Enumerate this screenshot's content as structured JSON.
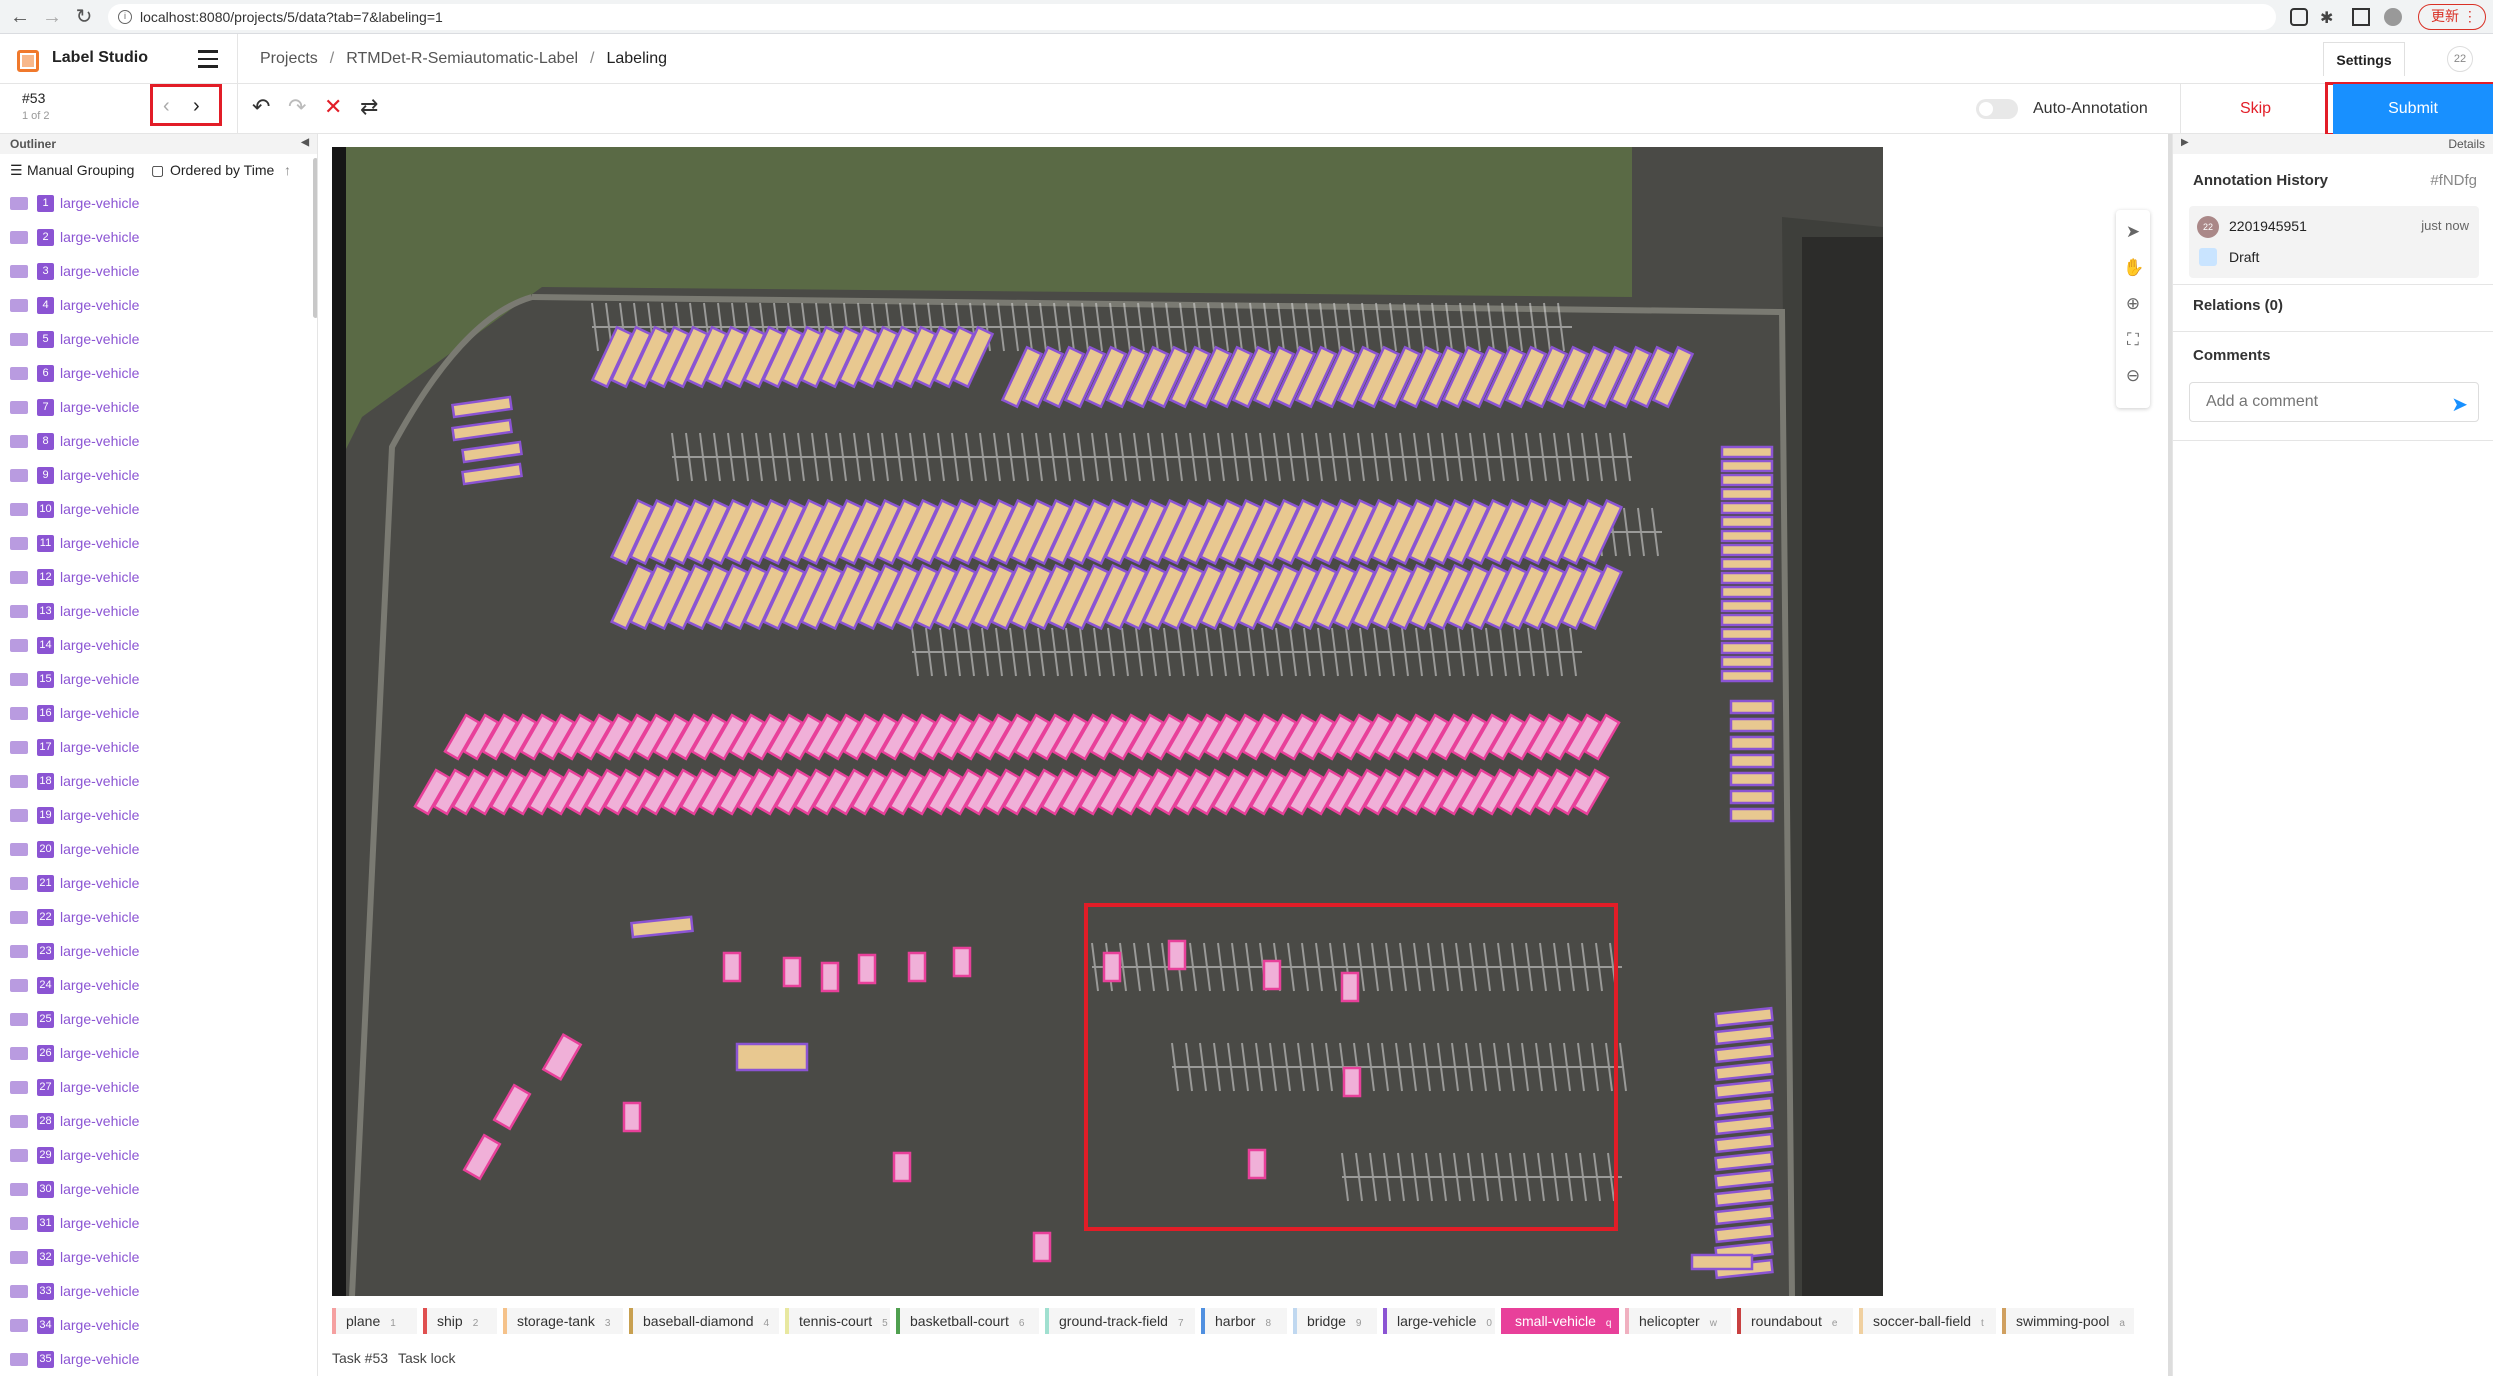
{
  "browser": {
    "url": "localhost:8080/projects/5/data?tab=7&labeling=1",
    "update_label": "更新"
  },
  "header": {
    "app_name": "Label Studio",
    "breadcrumb": [
      "Projects",
      "RTMDet-R-Semiautomatic-Label",
      "Labeling"
    ],
    "settings_label": "Settings",
    "user_count": "22"
  },
  "toolbar": {
    "task_id": "#53",
    "task_position": "1 of 2",
    "auto_annotation_label": "Auto-Annotation",
    "skip_label": "Skip",
    "submit_label": "Submit"
  },
  "outliner": {
    "title": "Outliner",
    "grouping_label": "Manual Grouping",
    "ordering_label": "Ordered by Time",
    "region_color": "#8b54d3",
    "regions": [
      {
        "n": "1",
        "label": "large-vehicle"
      },
      {
        "n": "2",
        "label": "large-vehicle"
      },
      {
        "n": "3",
        "label": "large-vehicle"
      },
      {
        "n": "4",
        "label": "large-vehicle"
      },
      {
        "n": "5",
        "label": "large-vehicle"
      },
      {
        "n": "6",
        "label": "large-vehicle"
      },
      {
        "n": "7",
        "label": "large-vehicle"
      },
      {
        "n": "8",
        "label": "large-vehicle"
      },
      {
        "n": "9",
        "label": "large-vehicle"
      },
      {
        "n": "10",
        "label": "large-vehicle"
      },
      {
        "n": "11",
        "label": "large-vehicle"
      },
      {
        "n": "12",
        "label": "large-vehicle"
      },
      {
        "n": "13",
        "label": "large-vehicle"
      },
      {
        "n": "14",
        "label": "large-vehicle"
      },
      {
        "n": "15",
        "label": "large-vehicle"
      },
      {
        "n": "16",
        "label": "large-vehicle"
      },
      {
        "n": "17",
        "label": "large-vehicle"
      },
      {
        "n": "18",
        "label": "large-vehicle"
      },
      {
        "n": "19",
        "label": "large-vehicle"
      },
      {
        "n": "20",
        "label": "large-vehicle"
      },
      {
        "n": "21",
        "label": "large-vehicle"
      },
      {
        "n": "22",
        "label": "large-vehicle"
      },
      {
        "n": "23",
        "label": "large-vehicle"
      },
      {
        "n": "24",
        "label": "large-vehicle"
      },
      {
        "n": "25",
        "label": "large-vehicle"
      },
      {
        "n": "26",
        "label": "large-vehicle"
      },
      {
        "n": "27",
        "label": "large-vehicle"
      },
      {
        "n": "28",
        "label": "large-vehicle"
      },
      {
        "n": "29",
        "label": "large-vehicle"
      },
      {
        "n": "30",
        "label": "large-vehicle"
      },
      {
        "n": "31",
        "label": "large-vehicle"
      },
      {
        "n": "32",
        "label": "large-vehicle"
      },
      {
        "n": "33",
        "label": "large-vehicle"
      },
      {
        "n": "34",
        "label": "large-vehicle"
      },
      {
        "n": "35",
        "label": "large-vehicle"
      }
    ]
  },
  "labels": [
    {
      "name": "plane",
      "key": "1",
      "color": "#f5a0a0"
    },
    {
      "name": "ship",
      "key": "2",
      "color": "#e05050"
    },
    {
      "name": "storage-tank",
      "key": "3",
      "color": "#f5c28a"
    },
    {
      "name": "baseball-diamond",
      "key": "4",
      "color": "#c8a050"
    },
    {
      "name": "tennis-court",
      "key": "5",
      "color": "#e8e8a0"
    },
    {
      "name": "basketball-court",
      "key": "6",
      "color": "#50a050"
    },
    {
      "name": "ground-track-field",
      "key": "7",
      "color": "#a0e0d0"
    },
    {
      "name": "harbor",
      "key": "8",
      "color": "#5090e0"
    },
    {
      "name": "bridge",
      "key": "9",
      "color": "#c0d8f0"
    },
    {
      "name": "large-vehicle",
      "key": "0",
      "color": "#8b54d3"
    },
    {
      "name": "small-vehicle",
      "key": "q",
      "color": "#e8409a"
    },
    {
      "name": "helicopter",
      "key": "w",
      "color": "#f0b0c0"
    },
    {
      "name": "roundabout",
      "key": "e",
      "color": "#c84040"
    },
    {
      "name": "soccer-ball-field",
      "key": "t",
      "color": "#f0d0a0"
    },
    {
      "name": "swimming-pool",
      "key": "a",
      "color": "#d0a060"
    }
  ],
  "status": {
    "task_label": "Task #53",
    "lock_label": "Task lock"
  },
  "details": {
    "title": "Details",
    "history_title": "Annotation History",
    "history_id": "#fNDfg",
    "history_user": "2201945951",
    "history_avatar": "22",
    "history_time": "just now",
    "history_status": "Draft",
    "relations_label": "Relations (0)",
    "comments_title": "Comments",
    "comment_placeholder": "Add a comment"
  },
  "colors": {
    "accent": "#1890ff",
    "highlight_red": "#e21d27",
    "large_vehicle": "#8b54d3",
    "small_vehicle": "#e8409a"
  }
}
